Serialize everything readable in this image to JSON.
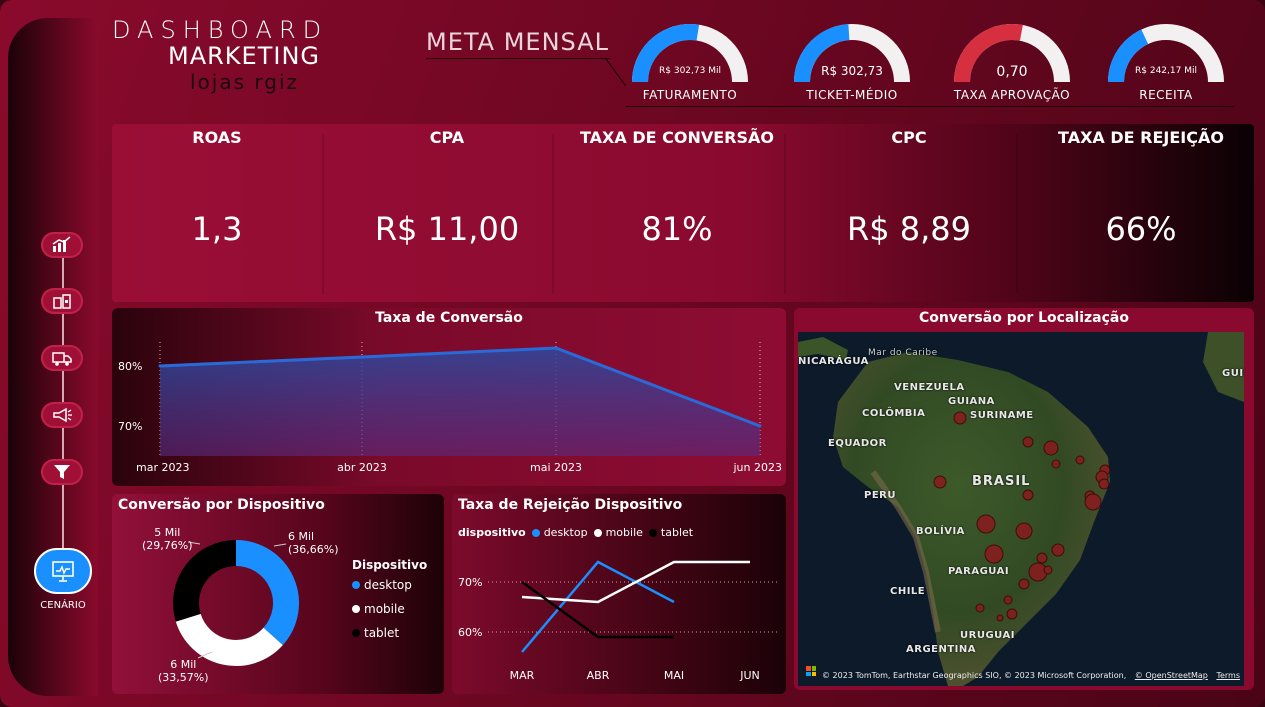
{
  "header": {
    "title_line1": "DASHBOARD",
    "title_line2": "MARKETING",
    "title_line3": "lojas rgiz",
    "meta_title": "META MENSAL"
  },
  "gauges": [
    {
      "value": "R$ 302,73 Mil",
      "label": "FATURAMENTO",
      "fill": 0.55,
      "color": "#1a8fff"
    },
    {
      "value": "R$ 302,73",
      "label": "TICKET-MÉDIO",
      "fill": 0.48,
      "color": "#1a8fff"
    },
    {
      "value": "0,70",
      "label": "TAXA APROVAÇÃO",
      "fill": 0.56,
      "color": "#d62f3f"
    },
    {
      "value": "R$ 242,17 Mil",
      "label": "RECEITA",
      "fill": 0.36,
      "color": "#1a8fff"
    }
  ],
  "kpis": [
    {
      "title": "ROAS",
      "value": "1,3"
    },
    {
      "title": "CPA",
      "value": "R$ 11,00"
    },
    {
      "title": "TAXA DE CONVERSÃO",
      "value": "81%"
    },
    {
      "title": "CPC",
      "value": "R$ 8,89"
    },
    {
      "title": "TAXA DE REJEIÇÃO",
      "value": "66%"
    }
  ],
  "sidebar": {
    "items": [
      {
        "icon": "chart-icon"
      },
      {
        "icon": "store-icon"
      },
      {
        "icon": "truck-icon"
      },
      {
        "icon": "megaphone-icon"
      },
      {
        "icon": "filter-icon"
      }
    ],
    "active_label": "CENÁRIO",
    "active_icon": "presentation-icon"
  },
  "conversion_card": {
    "title": "Taxa de Conversão"
  },
  "device_card": {
    "title": "Conversão por Dispositivo",
    "legend_title": "Dispositivo",
    "labels": [
      {
        "line1": "6 Mil",
        "line2": "(36,66%)"
      },
      {
        "line1": "6 Mil",
        "line2": "(33,57%)"
      },
      {
        "line1": "5 Mil",
        "line2": "(29,76%)"
      }
    ]
  },
  "rejection_card": {
    "title": "Taxa de Rejeição Dispositivo",
    "legend_title": "dispositivo"
  },
  "map_card": {
    "title": "Conversão por Localização",
    "labels": {
      "caribe": "Mar do Caribe",
      "nicaragua": "NICARÁGUA",
      "venezuela": "VENEZUELA",
      "guiana": "GUIANA",
      "suriname": "SURINAME",
      "colombia": "COLÔMBIA",
      "equador": "EQUADOR",
      "brasil": "BRASIL",
      "peru": "PERU",
      "bolivia": "BOLÍVIA",
      "paraguai": "PARAGUAI",
      "chile": "CHILE",
      "uruguai": "URUGUAI",
      "argentina": "ARGENTINA",
      "guin": "GUIN"
    },
    "attribution": "© 2023 TomTom, Earthstar Geographics SIO, © 2023 Microsoft Corporation,",
    "osm": "© OpenStreetMap",
    "terms": "Terms"
  },
  "chart_data": [
    {
      "type": "area",
      "title": "Taxa de Conversão",
      "x": [
        "mar 2023",
        "abr 2023",
        "mai 2023",
        "jun 2023"
      ],
      "values": [
        80,
        81.5,
        83,
        70
      ],
      "y_ticks": [
        "80%",
        "70%"
      ],
      "ylim": [
        66,
        86
      ],
      "grid": "vertical dotted"
    },
    {
      "type": "pie",
      "title": "Conversão por Dispositivo",
      "categories": [
        "desktop",
        "mobile",
        "tablet"
      ],
      "values": [
        36.66,
        33.57,
        29.76
      ],
      "colors": [
        "#1a8fff",
        "#ffffff",
        "#000000"
      ]
    },
    {
      "type": "line",
      "title": "Taxa de Rejeição Dispositivo",
      "categories": [
        "MAR",
        "ABR",
        "MAI",
        "JUN"
      ],
      "y_ticks": [
        "70%",
        "60%"
      ],
      "ylim": [
        54,
        78
      ],
      "series": [
        {
          "name": "desktop",
          "values": [
            56,
            74,
            66,
            null
          ],
          "color": "#1a8fff"
        },
        {
          "name": "mobile",
          "values": [
            67,
            66,
            74,
            74
          ],
          "color": "#ffffff"
        },
        {
          "name": "tablet",
          "values": [
            70,
            59,
            59,
            null
          ],
          "color": "#000000"
        }
      ]
    }
  ]
}
